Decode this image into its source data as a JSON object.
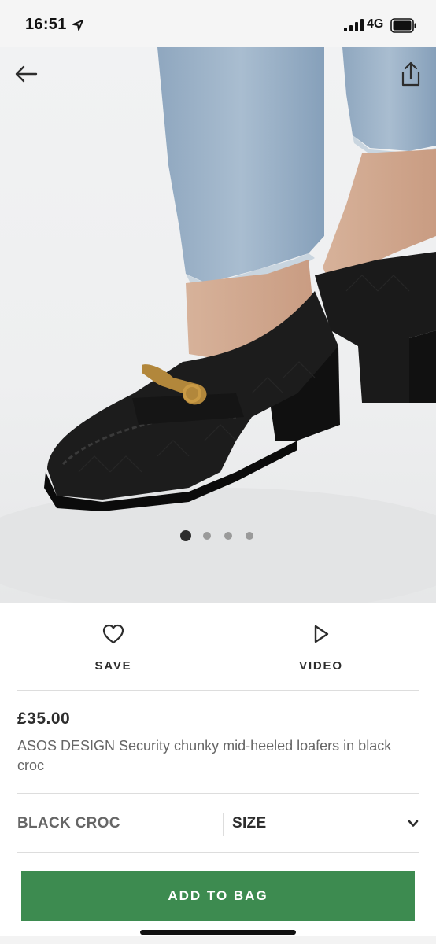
{
  "status_bar": {
    "time": "16:51",
    "network": "4G",
    "icons": [
      "location-arrow-icon",
      "signal-icon",
      "battery-icon"
    ]
  },
  "gallery": {
    "image_subject": "black croc loafer",
    "image_count": 4,
    "active_index": 0,
    "icons": [
      "back-arrow-icon",
      "share-icon"
    ]
  },
  "actions": {
    "save_label": "SAVE",
    "save_icon": "heart-icon",
    "video_label": "VIDEO",
    "video_icon": "play-icon"
  },
  "product": {
    "price": "£35.00",
    "title": "ASOS DESIGN Security chunky mid-heeled loafers in black croc"
  },
  "selectors": {
    "colour": "BLACK CROC",
    "size_label": "SIZE",
    "size_icon": "chevron-down-icon"
  },
  "cta": {
    "add_to_bag_label": "ADD TO BAG",
    "color": "#3d8b50"
  }
}
